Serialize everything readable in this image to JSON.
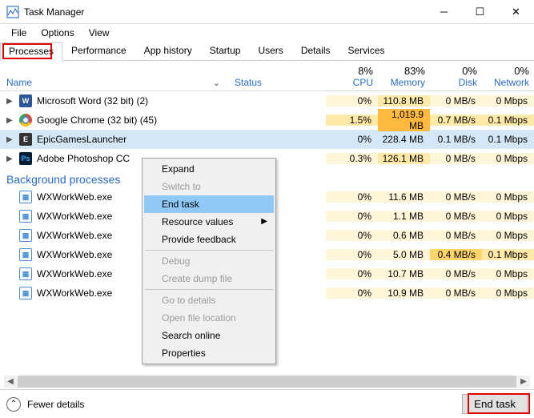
{
  "window": {
    "title": "Task Manager"
  },
  "menu": [
    "File",
    "Options",
    "View"
  ],
  "tabs": [
    "Processes",
    "Performance",
    "App history",
    "Startup",
    "Users",
    "Details",
    "Services"
  ],
  "columns": {
    "name": "Name",
    "status": "Status",
    "cpu": {
      "pct": "8%",
      "label": "CPU"
    },
    "mem": {
      "pct": "83%",
      "label": "Memory"
    },
    "disk": {
      "pct": "0%",
      "label": "Disk"
    },
    "net": {
      "pct": "0%",
      "label": "Network"
    }
  },
  "processes": [
    {
      "name": "Microsoft Word (32 bit) (2)",
      "cpu": "0%",
      "mem": "110.8 MB",
      "disk": "0 MB/s",
      "net": "0 Mbps",
      "icon": "word"
    },
    {
      "name": "Google Chrome (32 bit) (45)",
      "cpu": "1.5%",
      "mem": "1,019.9 MB",
      "disk": "0.7 MB/s",
      "net": "0.1 Mbps",
      "icon": "chrome"
    },
    {
      "name": "EpicGamesLauncher",
      "cpu": "0%",
      "mem": "228.4 MB",
      "disk": "0.1 MB/s",
      "net": "0.1 Mbps",
      "icon": "epic",
      "selected": true
    },
    {
      "name": "Adobe Photoshop CC",
      "cpu": "0.3%",
      "mem": "126.1 MB",
      "disk": "0 MB/s",
      "net": "0 Mbps",
      "icon": "ps"
    }
  ],
  "section": "Background processes",
  "bg": [
    {
      "name": "WXWorkWeb.exe",
      "cpu": "0%",
      "mem": "11.6 MB",
      "disk": "0 MB/s",
      "net": "0 Mbps"
    },
    {
      "name": "WXWorkWeb.exe",
      "cpu": "0%",
      "mem": "1.1 MB",
      "disk": "0 MB/s",
      "net": "0 Mbps"
    },
    {
      "name": "WXWorkWeb.exe",
      "cpu": "0%",
      "mem": "0.6 MB",
      "disk": "0 MB/s",
      "net": "0 Mbps"
    },
    {
      "name": "WXWorkWeb.exe",
      "cpu": "0%",
      "mem": "5.0 MB",
      "disk": "0.4 MB/s",
      "net": "0.1 Mbps"
    },
    {
      "name": "WXWorkWeb.exe",
      "cpu": "0%",
      "mem": "10.7 MB",
      "disk": "0 MB/s",
      "net": "0 Mbps"
    },
    {
      "name": "WXWorkWeb.exe",
      "cpu": "0%",
      "mem": "10.9 MB",
      "disk": "0 MB/s",
      "net": "0 Mbps"
    }
  ],
  "ctx": {
    "expand": "Expand",
    "switch": "Switch to",
    "end": "End task",
    "res": "Resource values",
    "feedback": "Provide feedback",
    "debug": "Debug",
    "dump": "Create dump file",
    "details": "Go to details",
    "open": "Open file location",
    "search": "Search online",
    "props": "Properties"
  },
  "footer": {
    "fewer": "Fewer details",
    "end": "End task"
  }
}
